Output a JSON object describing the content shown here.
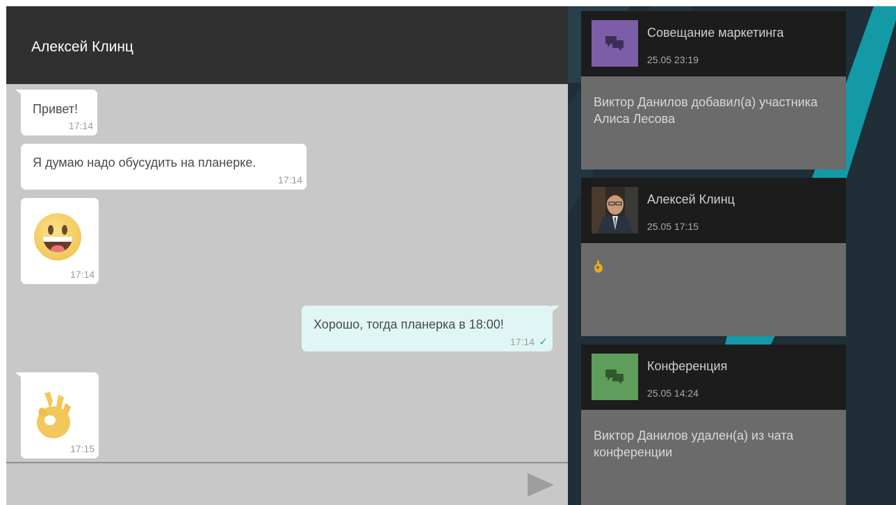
{
  "chat": {
    "title": "Алексей Клинц",
    "messages": [
      {
        "text": "Привет!",
        "time": "17:14"
      },
      {
        "text": "Я думаю надо обусудить на планерке.",
        "time": "17:14"
      },
      {
        "emoji": "grinning-face",
        "time": "17:14"
      },
      {
        "text": "Хорошо, тогда планерка в 18:00!",
        "time": "17:14",
        "status": "sent-check"
      },
      {
        "emoji": "ok-hand",
        "time": "17:15"
      }
    ]
  },
  "conversations": [
    {
      "title": "Совещание маркетинга",
      "time": "25.05 23:19",
      "preview": "Виктор Данилов добавил(а) участника Алиса Лесова",
      "icon": "group-chat-icon",
      "icon_color": "#7b5ea7"
    },
    {
      "title": "Алексей Клинц",
      "time": "25.05 17:15",
      "preview_emoji": "ok-hand",
      "icon": "avatar-photo"
    },
    {
      "title": "Конференция",
      "time": "25.05 14:24",
      "preview": "Виктор Данилов удален(а) из чата конференции",
      "icon": "group-chat-icon",
      "icon_color": "#5e9e5a"
    }
  ],
  "colors": {
    "accent": "#1a9aa8",
    "outgoing_bubble": "#e0f6f5",
    "chat_bg": "#c8c8c8",
    "header_bg": "#303030"
  }
}
